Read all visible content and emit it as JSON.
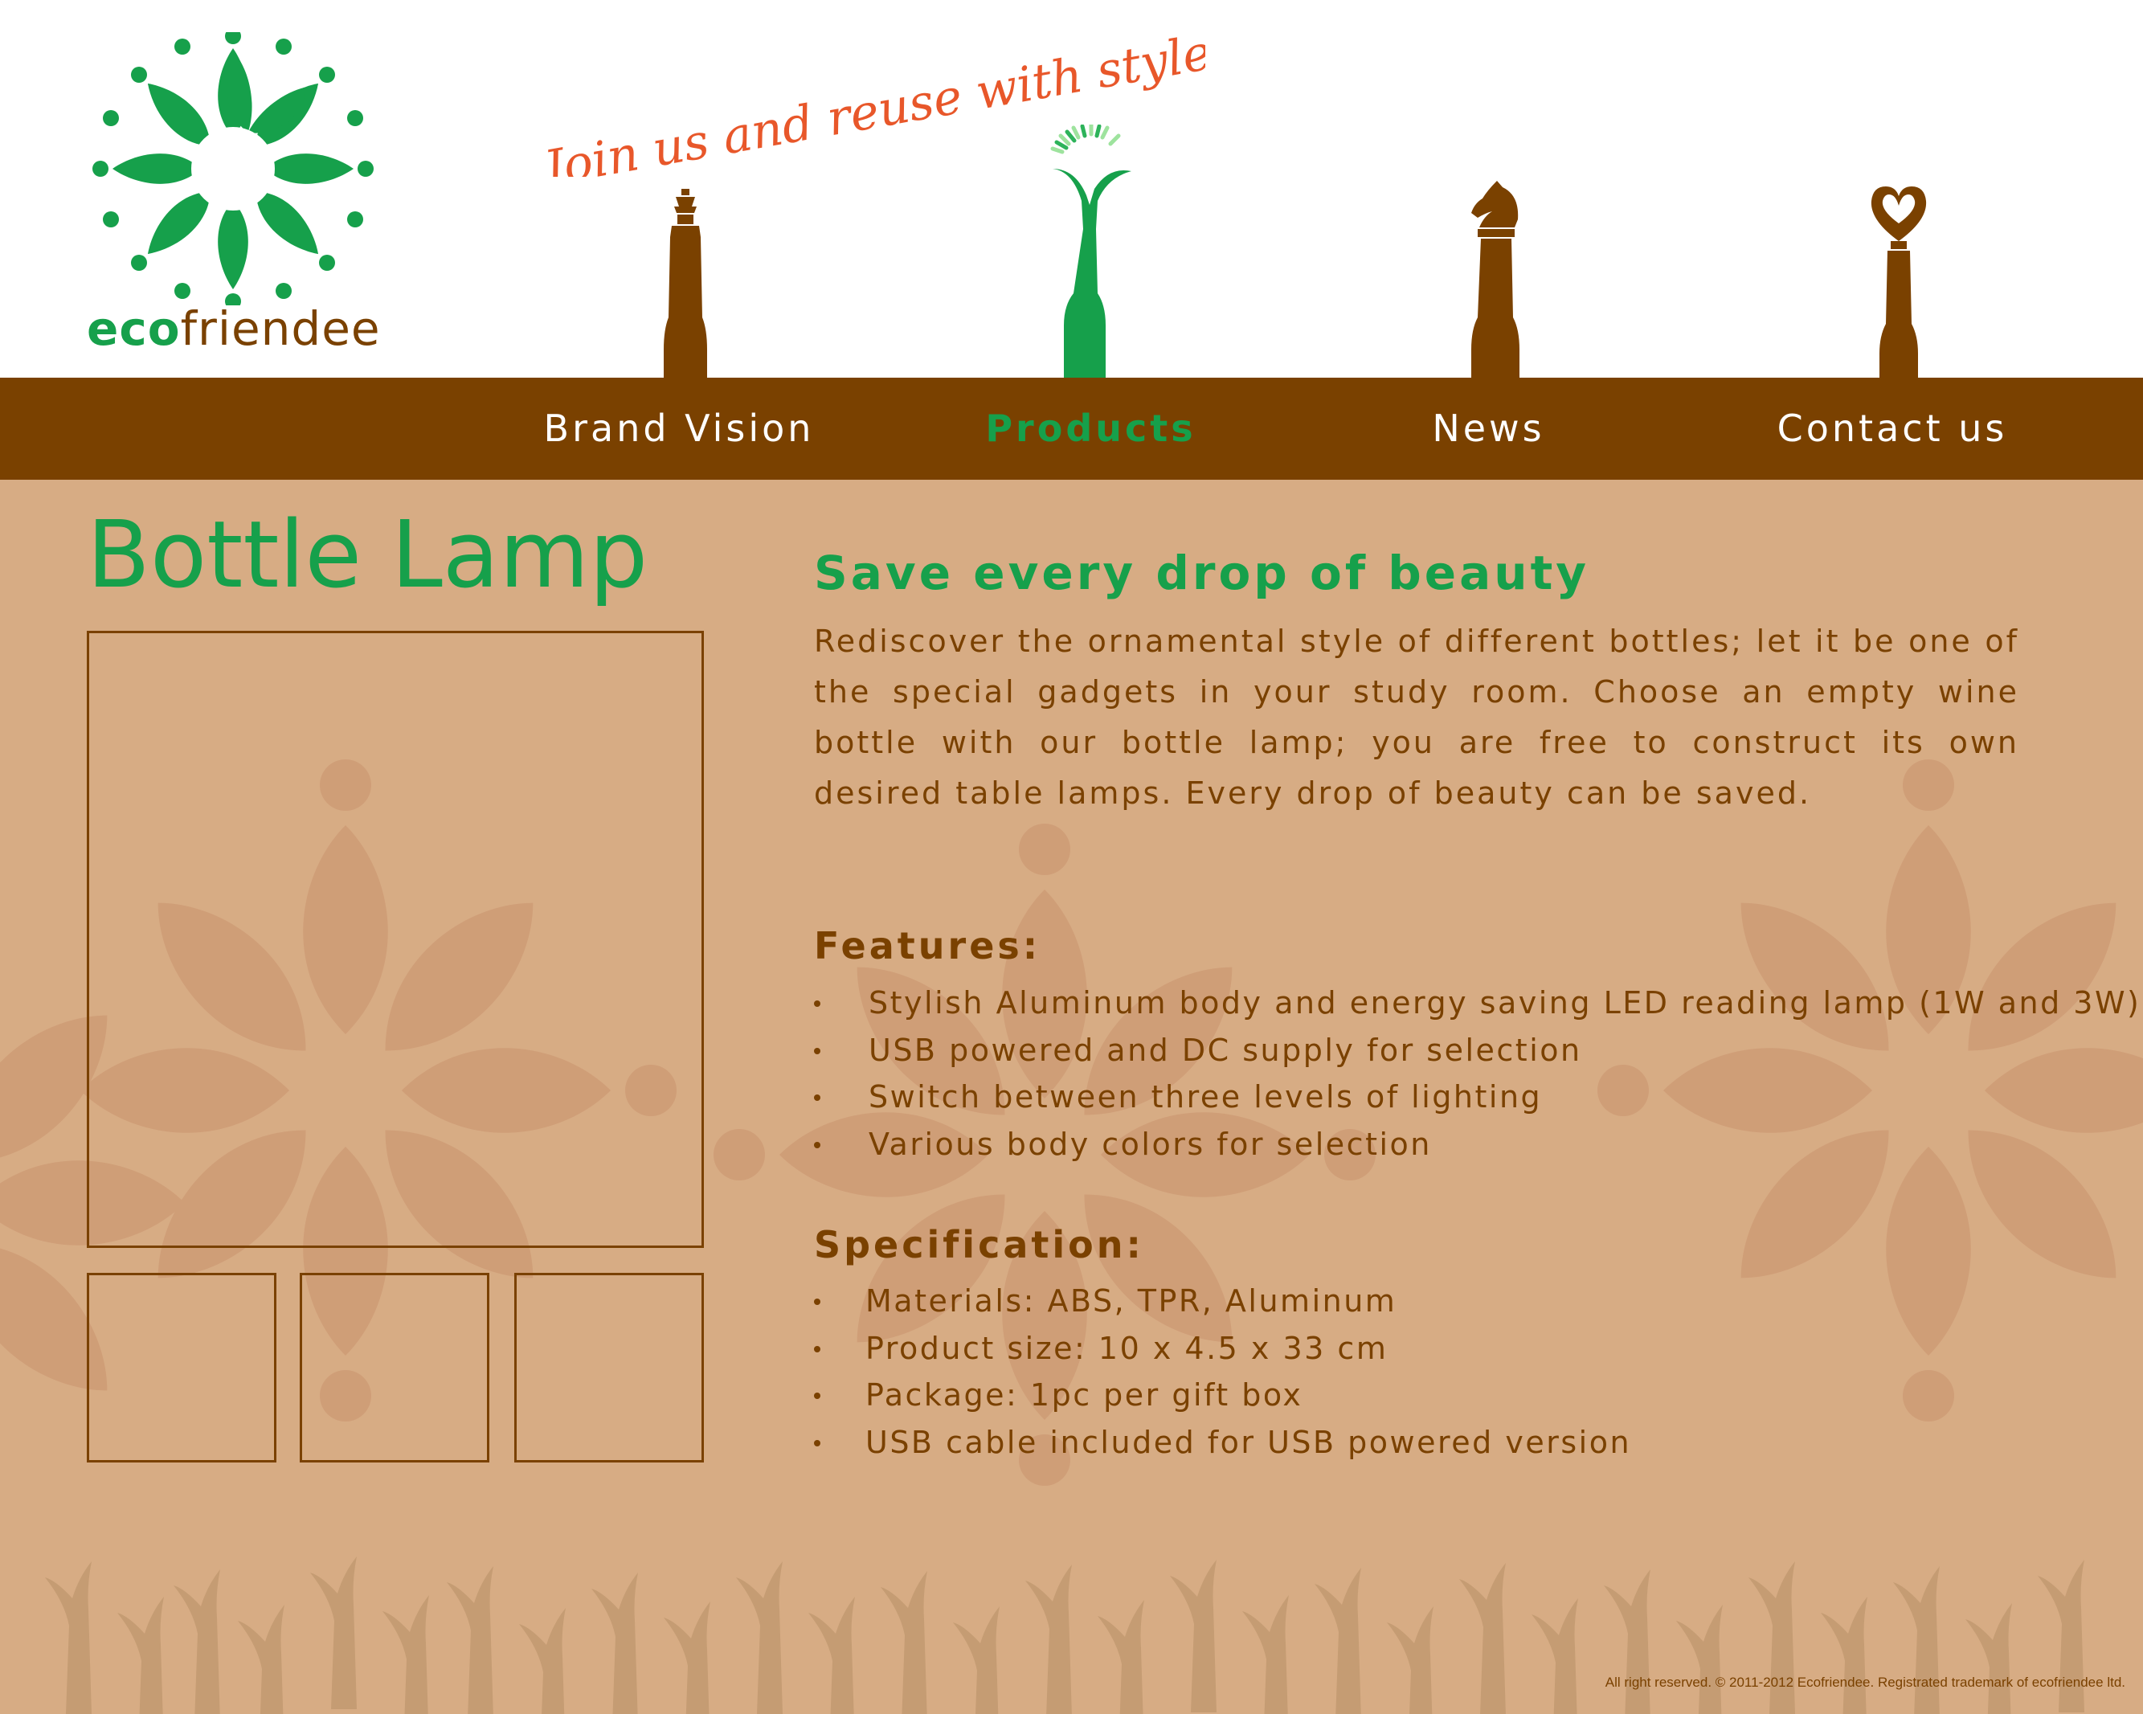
{
  "brand": {
    "name_part1": "eco",
    "name_part2": "friendee",
    "tagline": "Join us and reuse with style!"
  },
  "nav": {
    "items": [
      {
        "label": "Brand Vision",
        "active": false,
        "icon": "queen-chess-bottle-icon"
      },
      {
        "label": "Products",
        "active": true,
        "icon": "lamp-bottle-icon"
      },
      {
        "label": "News",
        "active": false,
        "icon": "knight-chess-bottle-icon"
      },
      {
        "label": "Contact us",
        "active": false,
        "icon": "heart-bottle-icon"
      }
    ]
  },
  "product": {
    "title": "Bottle Lamp",
    "headline": "Save every drop of beauty",
    "description": "Rediscover the ornamental style of different bottles; let it be one of the special gadgets in your study room. Choose an empty wine bottle with our bottle lamp; you are free to construct its own desired table lamps. Every drop of beauty can be saved.",
    "features_title": "Features:",
    "features": [
      "Stylish Aluminum body and energy saving LED reading lamp (1W and 3W)",
      "USB powered and DC supply for selection",
      "Switch between three levels of lighting",
      "Various body colors for selection"
    ],
    "spec_title": "Specification:",
    "specs": [
      "Materials: ABS, TPR, Aluminum",
      "Product size: 10 x 4.5 x 33 cm",
      "Package: 1pc per gift box",
      "USB cable included for USB powered version"
    ]
  },
  "footer": {
    "text": "All right reserved. © 2011-2012 Ecofriendee. Registrated trademark of ecofriendee ltd."
  },
  "colors": {
    "green": "#16a04b",
    "brown": "#7a4100",
    "tan": "#d7ac84",
    "tagline_orange": "#e8572a"
  }
}
